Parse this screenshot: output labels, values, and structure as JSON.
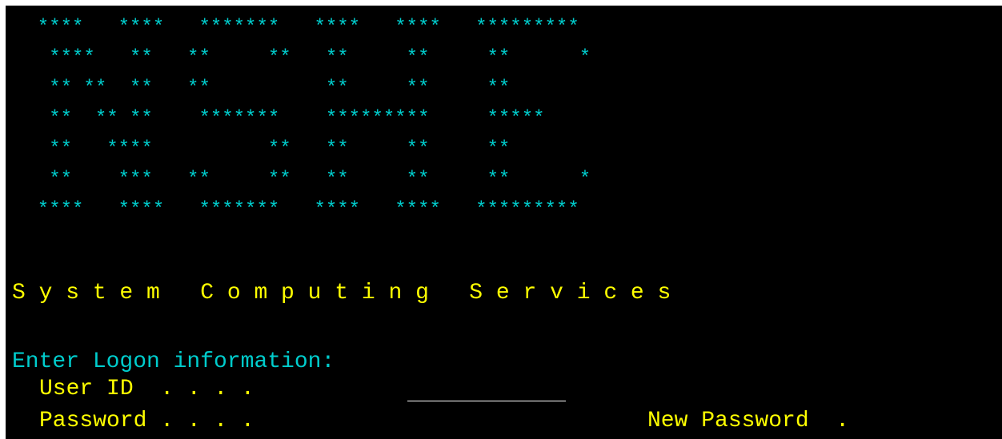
{
  "colors": {
    "background": "#000000",
    "banner": "#00cccc",
    "title": "#ffff00",
    "prompt": "#00cccc",
    "field_label": "#ffff00",
    "input_underline": "#ffffff"
  },
  "banner": {
    "rows": [
      "  ****   ****   *******   ****   ****   *********",
      "   ****   **   **     **   **     **     **      *",
      "   ** **  **   **          **     **     **",
      "   **  ** **    *******    *********     *****",
      "   **   ****          **   **     **     **",
      "   **    ***   **     **   **     **     **      *",
      "  ****   ****   *******   ****   ****   *********"
    ]
  },
  "title": "S y s t e m   C o m p u t i n g   S e r v i c e s",
  "logon": {
    "prompt": "Enter Logon information:",
    "user_id_label": "User ID  . . . .",
    "user_id_value": "",
    "password_label": "Password . . . .",
    "password_value": "",
    "new_password_label": "New Password  .",
    "new_password_value": ""
  }
}
